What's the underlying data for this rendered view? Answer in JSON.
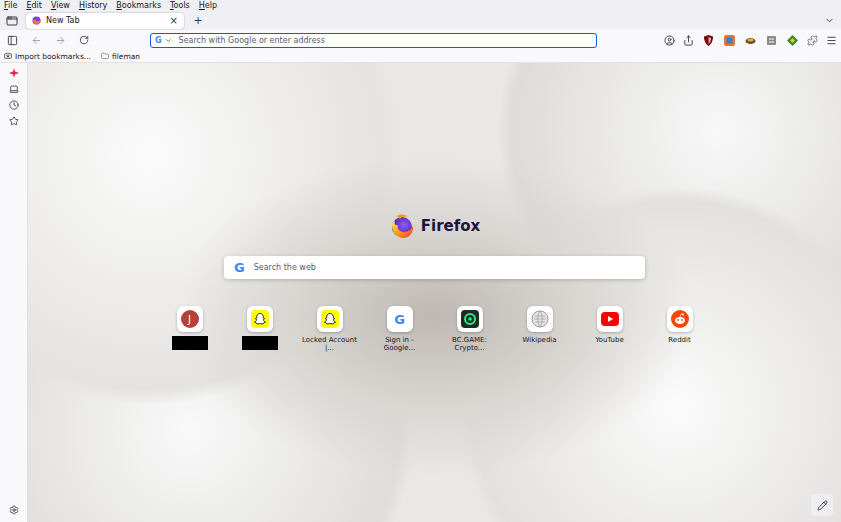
{
  "menu": [
    "File",
    "Edit",
    "View",
    "History",
    "Bookmarks",
    "Tools",
    "Help"
  ],
  "tabs": [
    {
      "label": "New Tab",
      "selected": true,
      "close": "×"
    }
  ],
  "new_tab_button": "+",
  "address_bar": {
    "engine": "G",
    "placeholder": "Search with Google or enter address"
  },
  "bookmarks": [
    {
      "label": "Import bookmarks...",
      "kind": "import"
    },
    {
      "label": "fileman",
      "kind": "folder"
    }
  ],
  "brand": "Firefox",
  "search": {
    "engine": "G",
    "placeholder": "Search the web"
  },
  "top_sites": [
    {
      "label": "",
      "redacted": true,
      "kind": "letter",
      "glyph": "J",
      "color": "#b5413a"
    },
    {
      "label": "",
      "redacted": true,
      "kind": "snapchat",
      "glyph": "",
      "color": "#fffc00"
    },
    {
      "label": "Locked Account |...",
      "redacted": false,
      "kind": "snapchat",
      "glyph": "",
      "color": "#fffc00"
    },
    {
      "label": "Sign in - Google...",
      "redacted": false,
      "kind": "google",
      "glyph": "G",
      "color": "#4285f4"
    },
    {
      "label": "BC.GAME: Crypto...",
      "redacted": false,
      "kind": "bcgame",
      "glyph": "",
      "color": "#1e2a23"
    },
    {
      "label": "Wikipedia",
      "redacted": false,
      "kind": "wikipedia",
      "glyph": "",
      "color": "#9a9a9a"
    },
    {
      "label": "YouTube",
      "redacted": false,
      "kind": "youtube",
      "glyph": "",
      "color": "#ff0000"
    },
    {
      "label": "Reddit",
      "redacted": false,
      "kind": "reddit",
      "glyph": "",
      "color": "#ff4500"
    }
  ]
}
